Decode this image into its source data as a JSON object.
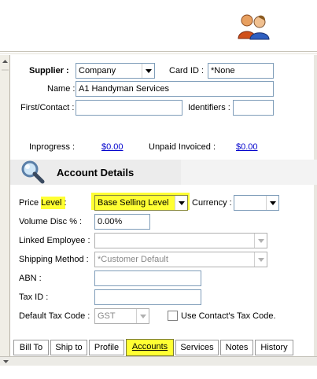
{
  "supplier": {
    "label": "Supplier :",
    "value": "Company",
    "card_id_label": "Card ID :",
    "card_id_value": "*None",
    "name_label": "Name :",
    "name_value": "A1 Handyman Services",
    "first_contact_label": "First/Contact :",
    "first_contact_value": "",
    "identifiers_label": "Identifiers :",
    "identifiers_value": ""
  },
  "summary": {
    "inprogress_label": "Inprogress :",
    "inprogress_value": "$0.00",
    "unpaid_label": "Unpaid Invoiced :",
    "unpaid_value": "$0.00"
  },
  "section": {
    "title": "Account Details"
  },
  "account": {
    "price_label_prefix": "Price ",
    "price_label_highlight": "Level",
    "price_label_suffix": " :",
    "price_level_value": "Base Selling Level",
    "currency_label": "Currency :",
    "currency_value": "",
    "volume_disc_label": "Volume Disc % :",
    "volume_disc_value": "0.00%",
    "linked_employee_label": "Linked Employee :",
    "linked_employee_value": "",
    "shipping_method_label": "Shipping Method :",
    "shipping_method_value": "*Customer Default",
    "abn_label": "ABN :",
    "abn_value": "",
    "tax_id_label": "Tax ID :",
    "tax_id_value": "",
    "default_tax_code_label": "Default Tax Code :",
    "default_tax_code_value": "GST",
    "use_contact_tax_label": "Use Contact's Tax Code."
  },
  "tabs": [
    {
      "label": "Bill To",
      "active": false
    },
    {
      "label": "Ship to",
      "active": false
    },
    {
      "label": "Profile",
      "active": false
    },
    {
      "label": "Accounts",
      "active": true
    },
    {
      "label": "Services",
      "active": false
    },
    {
      "label": "Notes",
      "active": false
    },
    {
      "label": "History",
      "active": false
    }
  ],
  "colors": {
    "highlight": "#ffff33",
    "link": "#0000cc",
    "field_border": "#7f9db9"
  },
  "icons": {
    "header": "users-icon",
    "section": "magnifier-icon"
  }
}
